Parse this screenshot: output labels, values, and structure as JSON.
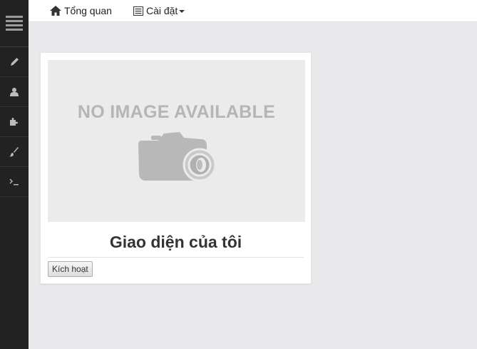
{
  "sidebar": {
    "items": [
      {
        "icon": "menu-icon"
      },
      {
        "icon": "pencil-icon"
      },
      {
        "icon": "user-icon"
      },
      {
        "icon": "puzzle-icon"
      },
      {
        "icon": "brush-icon"
      },
      {
        "icon": "terminal-icon"
      }
    ]
  },
  "topnav": {
    "overview_label": "Tổng quan",
    "settings_label": "Cài đặt"
  },
  "theme_card": {
    "placeholder_text": "NO IMAGE AVAILABLE",
    "title": "Giao diện của tôi",
    "activate_label": "Kích hoạt"
  },
  "colors": {
    "sidebar_bg": "#222222",
    "page_bg": "#e9e9ec",
    "card_bg": "#ffffff",
    "placeholder_bg": "#ebebeb"
  }
}
